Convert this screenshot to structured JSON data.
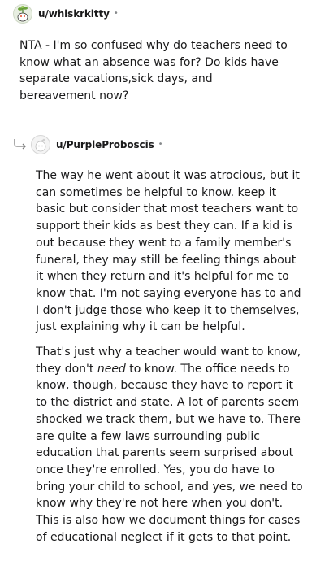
{
  "comments": [
    {
      "username": "u/whiskrkitty",
      "separator": "•",
      "avatar_icon": "snoo-avatar-plant-icon",
      "body": "NTA - I'm so confused why do teachers need to know what an absence was for? Do kids have separate vacations,sick days, and bereavement now?"
    },
    {
      "username": "u/PurpleProboscis",
      "separator": "•",
      "avatar_icon": "default-avatar-icon",
      "reply_icon": "reply-arrow-icon",
      "paragraphs": [
        "The way he went about it was atrocious, but it can sometimes be helpful to know. keep it basic but consider that most teachers want to support their kids as best they can. If a kid is out because they went to a family member's funeral, they may still be feeling things about it when they return and it's helpful for me to know that. I'm not saying everyone has to and I don't judge those who keep it to themselves, just explaining why it can be helpful."
      ],
      "p2": {
        "before": "That's just why a teacher would want to know, they don't ",
        "emphasis": "need",
        "after": " to know. The office needs to know, though, because they have to report it to the district and state. A lot of parents seem shocked we track them, but we have to. There are quite a few laws surrounding public education that parents seem surprised about once they're enrolled. Yes, you do have to bring your child to school, and yes, we need to know why they're not here when you don't. This is also how we document things for cases of educational neglect if it gets to that point."
      }
    }
  ]
}
